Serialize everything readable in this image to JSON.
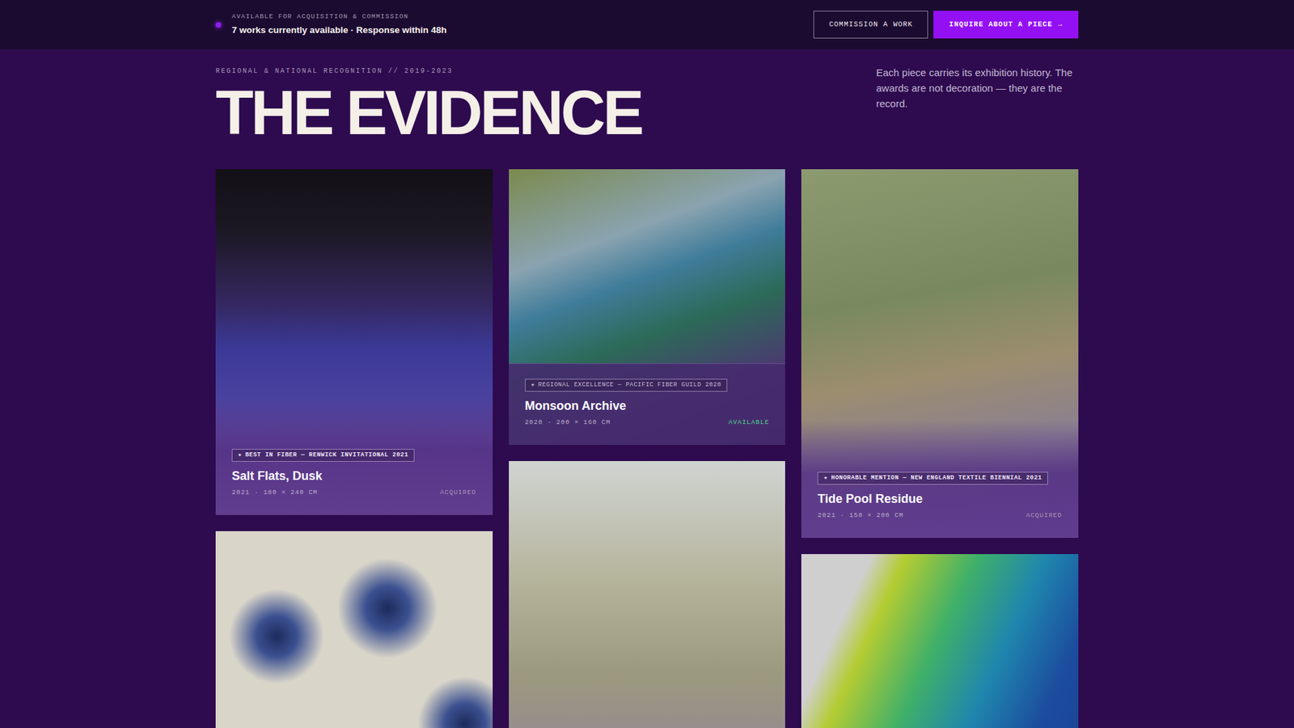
{
  "topbar": {
    "eyebrow": "AVAILABLE FOR ACQUISITION & COMMISSION",
    "summary": "7 works currently available · Response within 48h",
    "buttons": [
      {
        "label": "COMMISSION A WORK",
        "kind": "outline",
        "icon": ""
      },
      {
        "label": "INQUIRE ABOUT A PIECE",
        "kind": "primary",
        "icon": "→"
      }
    ]
  },
  "section": {
    "eyebrow": "REGIONAL & NATIONAL RECOGNITION // 2019-2023",
    "title": "THE EVIDENCE",
    "intro": "Each piece carries its exhibition history. The awards are not decoration — they are the record."
  },
  "works": [
    {
      "kind": "captioned",
      "title": "Salt Flats, Dusk",
      "meta": "2021 · 180 × 240 CM",
      "status": "ACQUIRED",
      "available": false,
      "award": {
        "icon": "★",
        "text": "BEST IN FIBER — RENWICK INVITATIONAL 2021"
      }
    },
    {
      "kind": "captioned",
      "title": "Monsoon Archive",
      "meta": "2020 · 200 × 160 CM",
      "status": "AVAILABLE",
      "available": true,
      "award": {
        "icon": "★",
        "text": "REGIONAL EXCELLENCE — PACIFIC FIBER GUILD 2020"
      }
    },
    {
      "kind": "captioned",
      "title": "Tide Pool Residue",
      "meta": "2021 · 150 × 200 CM",
      "status": "ACQUIRED",
      "available": false,
      "award": {
        "icon": "★",
        "text": "HONORABLE MENTION — NEW ENGLAND TEXTILE BIENNIAL 2021"
      }
    },
    {
      "kind": "image"
    },
    {
      "kind": "image"
    },
    {
      "kind": "image"
    }
  ]
}
